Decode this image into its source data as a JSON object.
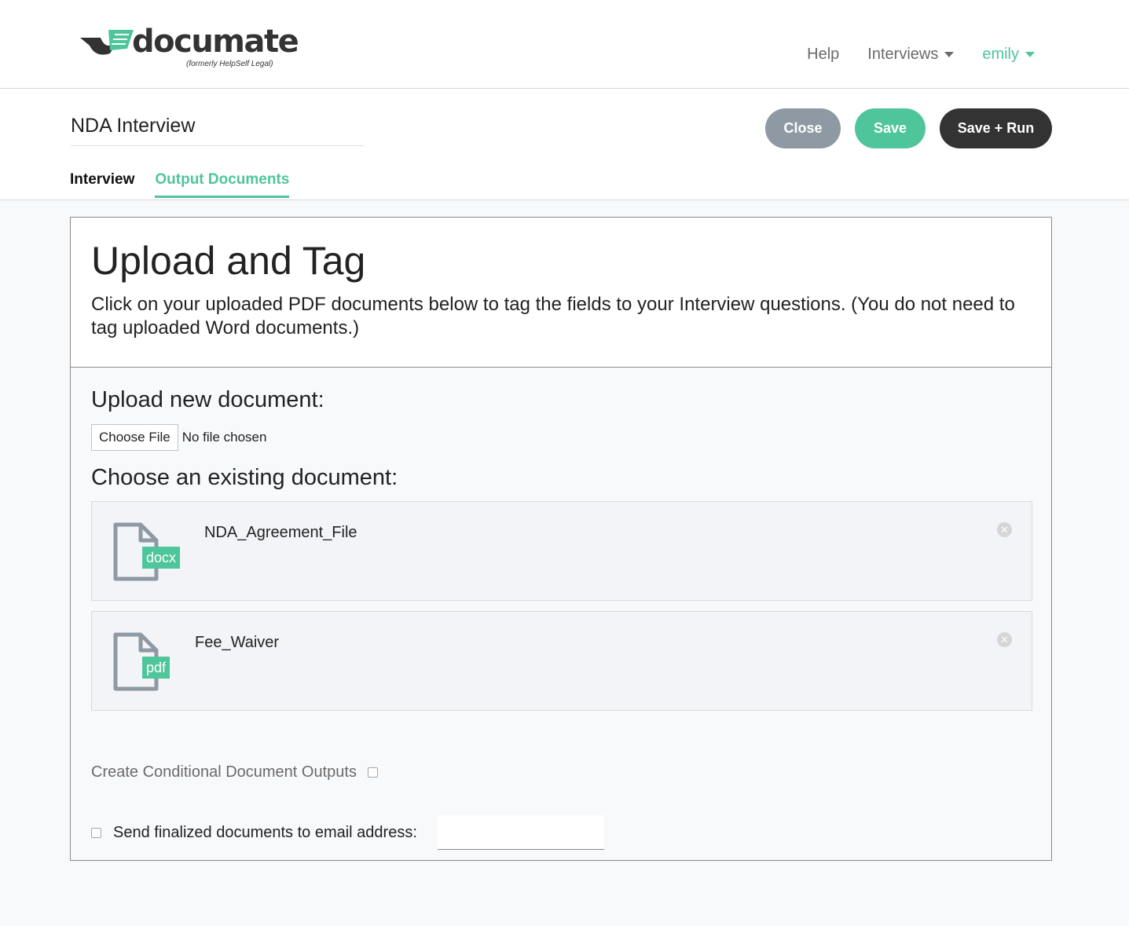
{
  "brand": {
    "logo_text": "documate",
    "logo_subtitle": "(formerly HelpSelf Legal)"
  },
  "nav": {
    "help": "Help",
    "interviews": "Interviews",
    "user": "emily"
  },
  "interview": {
    "title_value": "NDA Interview"
  },
  "buttons": {
    "close": "Close",
    "save": "Save",
    "save_run": "Save + Run"
  },
  "tabs": {
    "interview": "Interview",
    "output_documents": "Output Documents"
  },
  "panel": {
    "heading": "Upload and Tag",
    "description": "Click on your uploaded PDF documents below to tag the fields to your Interview questions. (You do not need to tag uploaded Word documents.)",
    "upload_title": "Upload new document:",
    "choose_file": "Choose File",
    "file_status": "No file chosen",
    "existing_title": "Choose an existing document:",
    "documents": [
      {
        "name": "NDA_Agreement_File",
        "type": "docx"
      },
      {
        "name": "Fee_Waiver",
        "type": "pdf"
      }
    ],
    "conditional_label": "Create Conditional Document Outputs",
    "email_label": "Send finalized documents to email address:",
    "email_value": ""
  },
  "colors": {
    "accent": "#4fc59b",
    "close_button": "#8e99a3",
    "dark_button": "#333333"
  }
}
